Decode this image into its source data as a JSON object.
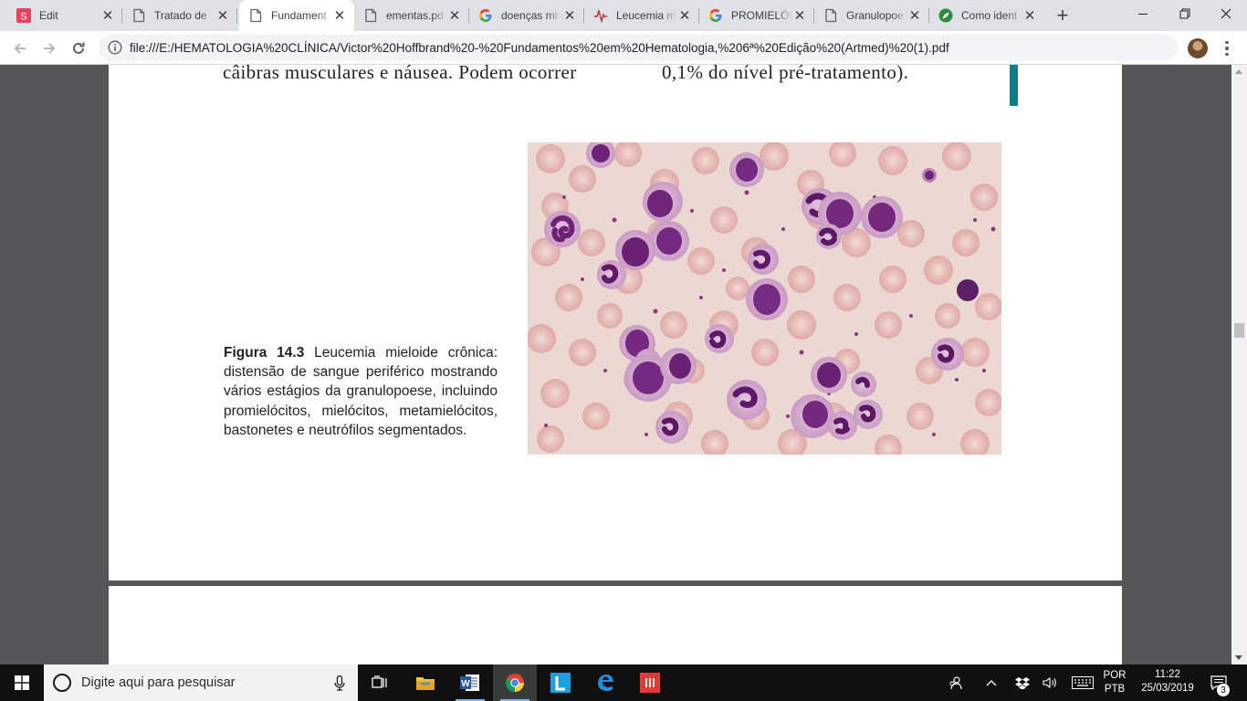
{
  "browser": {
    "tabs": [
      {
        "title": "Edit",
        "icon": "smallpdf-icon"
      },
      {
        "title": "Tratado de",
        "icon": "document-icon"
      },
      {
        "title": "Fundament",
        "icon": "document-icon"
      },
      {
        "title": "ementas.pd",
        "icon": "document-icon"
      },
      {
        "title": "doenças mi",
        "icon": "google-icon"
      },
      {
        "title": "Leucemia m",
        "icon": "ekg-icon"
      },
      {
        "title": "PROMIELÓC",
        "icon": "google-icon"
      },
      {
        "title": "Granulopoe",
        "icon": "document-icon"
      },
      {
        "title": "Como ident",
        "icon": "leaf-icon"
      }
    ],
    "active_tab": 2,
    "address_bar": {
      "url": "file:///E:/HEMATOLOGIA%20CLÍNICA/Victor%20Hoffbrand%20-%20Fundamentos%20em%20Hematologia,%206ª%20Edição%20(Artmed)%20(1).pdf"
    }
  },
  "pdf": {
    "body_left": "câibras musculares e náusea. Podem ocorrer",
    "body_right": "0,1% do nível pré-tratamento).",
    "figure": {
      "label": "Figura 14.3",
      "caption": " Leucemia mieloide crônica: distensão de sangue periférico mostrando vários estágios da granulopoese, incluindo promielócitos, mielócitos, metamielócitos, bastonetes e neutrófilos segmentados."
    }
  },
  "taskbar": {
    "search_placeholder": "Digite aqui para pesquisar",
    "apps": [
      "task-view-icon",
      "file-explorer-icon",
      "word-icon",
      "chrome-icon",
      "l-app-icon",
      "edge-icon",
      "red-app-icon"
    ],
    "language": "POR",
    "keyboard_layout": "PTB",
    "time": "11:22",
    "date": "25/03/2019",
    "notification_count": "3"
  },
  "colors": {
    "tabstrip": "#dee1e6",
    "viewer_bg": "#525659",
    "teal_accent": "#0e7c8c",
    "cell_nucleus": "#7a2a7e",
    "rbc": "#e4b9b6"
  }
}
